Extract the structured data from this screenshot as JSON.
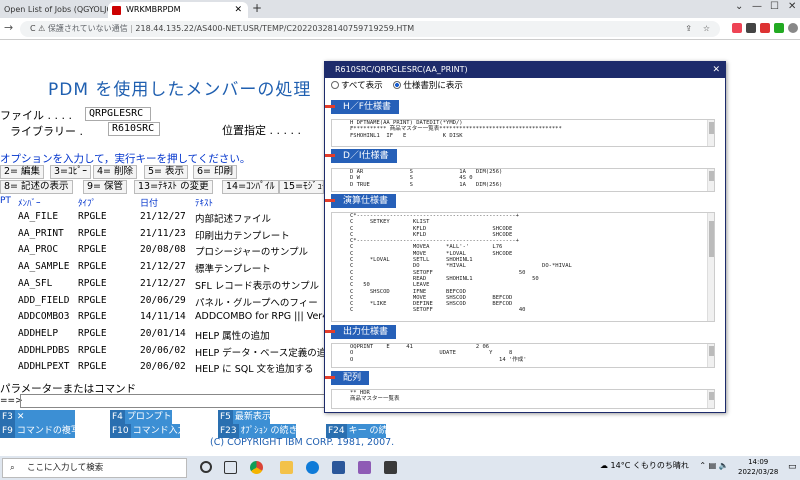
{
  "browser": {
    "tab1_title": "Open List of Jobs (QGYOLJOB) API",
    "tab2_title": "WRKMBRPDM",
    "url_warning": "保護されていない通信",
    "url": "218.44.135.22/AS400-NET.USR/TEMP/C20220328140759719259.HTM"
  },
  "page": {
    "title": "PDM を使用したメンバーの処理",
    "file_label": "ファイル . . . .",
    "file_value": "QRPGLESRC",
    "library_label": "ライブラリー .",
    "library_value": "R610SRC",
    "position_label": "位置指定 . . . . .",
    "instructions": "オプションを入力して，実行キーを押してください。",
    "options": [
      "2= 編集",
      "3=ｺﾋﾟｰ",
      "4= 削除",
      "5= 表示",
      "6= 印刷",
      "8= 記述の表示",
      "9= 保管",
      "13=ﾃｷｽﾄ の変更",
      "14=ｺﾝﾊﾟｲﾙ",
      "15=ﾓｼﾞｭｰﾙ"
    ],
    "columns": {
      "opt": "PT",
      "member": "ﾒﾝﾊﾞｰ",
      "type": "ﾀｲﾌﾟ",
      "date": "日付",
      "text": "ﾃｷｽﾄ"
    },
    "members": [
      {
        "name": "AA_FILE",
        "type": "RPGLE",
        "date": "21/12/27",
        "text": "内部記述ファイル"
      },
      {
        "name": "AA_PRINT",
        "type": "RPGLE",
        "date": "21/11/23",
        "text": "印刷出力テンプレート"
      },
      {
        "name": "AA_PROC",
        "type": "RPGLE",
        "date": "20/08/08",
        "text": "プロシージャーのサンプル"
      },
      {
        "name": "AA_SAMPLE",
        "type": "RPGLE",
        "date": "21/12/27",
        "text": "標準テンプレート"
      },
      {
        "name": "AA_SFL",
        "type": "RPGLE",
        "date": "21/12/27",
        "text": "SFL レコード表示のサンプル"
      },
      {
        "name": "ADD_FIELD",
        "type": "RPGLE",
        "date": "20/06/29",
        "text": "パネル・グループへのフィー"
      },
      {
        "name": "ADDCOMBO3",
        "type": "RPGLE",
        "date": "14/11/14",
        "text": "ADDCOMBO for RPG ||| Ver4."
      },
      {
        "name": "ADDHELP",
        "type": "RPGLE",
        "date": "20/01/14",
        "text": "HELP 属性の追加"
      },
      {
        "name": "ADDHLPDBS",
        "type": "RPGLE",
        "date": "20/06/02",
        "text": "HELP データ・ベース定義の追"
      },
      {
        "name": "ADDHLPEXT",
        "type": "RPGLE",
        "date": "20/06/02",
        "text": "HELP に SQL 文を追加する"
      }
    ],
    "command_label": "パラメーターまたはコマンド",
    "command_prompt": "==>",
    "fkeys": [
      {
        "key": "F3",
        "label": "✕"
      },
      {
        "key": "F4",
        "label": "プロンプト"
      },
      {
        "key": "F5",
        "label": "最新表示"
      },
      {
        "key": "F9",
        "label": "コマンドの複写"
      },
      {
        "key": "F10",
        "label": "コマンド入力"
      },
      {
        "key": "F23",
        "label": "ｵﾌﾟｼｮﾝ の続き"
      },
      {
        "key": "F24",
        "label": "キー の続き"
      }
    ],
    "copyright": "(C) COPYRIGHT IBM CORP. 1981, 2007."
  },
  "modal": {
    "title": "R610SRC/QRPGLESRC(AA_PRINT)",
    "radio_all": "すべて表示",
    "radio_spec": "仕様書別に表示",
    "sections": [
      {
        "header": "H／F仕様書",
        "code": "H DFTNAME(AA_PRINT) DATEDIT(*YMD/)\nF********** 商品マスター一覧表*************************************\nFSHOHINL1  IF   E           K DISK"
      },
      {
        "header": "D／I仕様書",
        "code": "D AR              S              1A   DIM(256)\nD W               S              4S 0\nD TRUE            S              1A   DIM(256)"
      },
      {
        "header": "演算仕様書",
        "code": "C*------------------------------------------------+\nC     SETKEY       KLIST\nC                  KFLD                    SHCODE\nC                  KFLD                    SHCODE\nC*------------------------------------------------+\nC                  MOVEA     *ALL'-'       L76\nC                  MOVE      *LOVAL        SHCODE\nC     *LOVAL       SETLL     SHOHINL1\nC                  DO        *HIVAL                       DO-*HIVAL\nC                  SETOFF                          50\nC                  READ      SHOHINL1                  50\nC   50             LEAVE\nC     SHSCOD       IFNE      BEFCOD\nC                  MOVE      SHSCOD        BEFCOD\nC     *LIKE        DEFINE    SHSCOD        BEFCOD\nC                  SETOFF                          40"
      },
      {
        "header": "出力仕様書",
        "code": "OQPRINT    E     41                   2 06\nO                          UDATE          Y     8\nO                                            14 '作成'"
      },
      {
        "header": "配列",
        "code": "** HDR\n商品マスター一覧表"
      }
    ]
  },
  "taskbar": {
    "search_placeholder": "ここに入力して検索",
    "weather": "14°C くもりのち晴れ",
    "time": "14:09",
    "date": "2022/03/28"
  }
}
